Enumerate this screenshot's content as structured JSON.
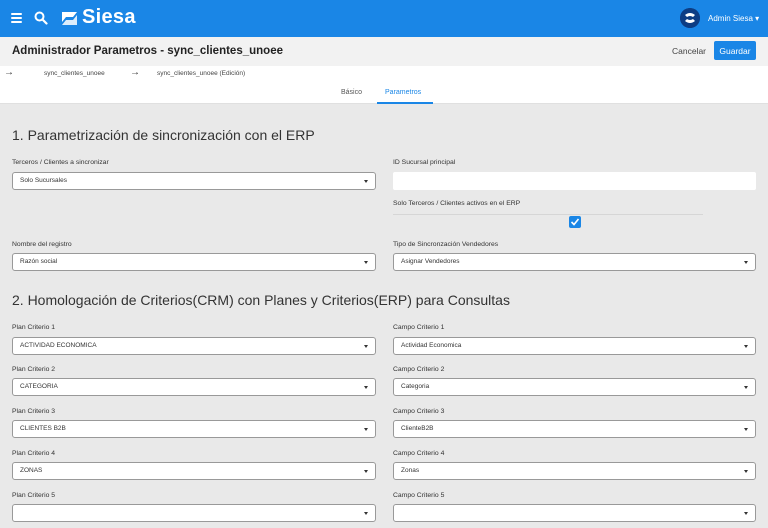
{
  "topbar": {
    "brand": "Siesa",
    "user_name": "Admin Siesa ▾"
  },
  "header": {
    "title": "Administrador Parametros - sync_clientes_unoee",
    "cancel_label": "Cancelar",
    "save_label": "Guardar"
  },
  "breadcrumb": {
    "items": [
      {
        "label": "sync_clientes_unoee"
      },
      {
        "label": "sync_clientes_unoee (Edición)"
      }
    ]
  },
  "tabs": [
    {
      "label": "Básico",
      "active": false
    },
    {
      "label": "Parametros",
      "active": true
    }
  ],
  "section1": {
    "title": "1. Parametrización de sincronización con el ERP",
    "terceros": {
      "label": "Terceros / Clientes a sincronizar",
      "value": "Solo Sucursales"
    },
    "sucursal": {
      "label": "ID Sucursal principal",
      "value": ""
    },
    "activos": {
      "label": "Solo Terceros / Clientes activos en el ERP",
      "checked": true
    },
    "nombre_registro": {
      "label": "Nombre del registro",
      "value": "Razón social"
    },
    "tipo_vendedores": {
      "label": "Tipo de Sincronzación Vendedores",
      "value": "Asignar Vendedores"
    }
  },
  "section2": {
    "title": "2. Homologación de Criterios(CRM) con Planes y Criterios(ERP) para Consultas",
    "rows": [
      {
        "plan_label": "Plan Criterio 1",
        "plan_value": "ACTIVIDAD ECONOMICA",
        "campo_label": "Campo Criterio 1",
        "campo_value": "Actividad Economica"
      },
      {
        "plan_label": "Plan Criterio 2",
        "plan_value": "CATEGORIA",
        "campo_label": "Campo Criterio 2",
        "campo_value": "Categoria"
      },
      {
        "plan_label": "Plan Criterio 3",
        "plan_value": "CLIENTES B2B",
        "campo_label": "Campo Criterio 3",
        "campo_value": "ClienteB2B"
      },
      {
        "plan_label": "Plan Criterio 4",
        "plan_value": "ZONAS",
        "campo_label": "Campo Criterio 4",
        "campo_value": "Zonas"
      },
      {
        "plan_label": "Plan Criterio 5",
        "plan_value": "",
        "campo_label": "Campo Criterio 5",
        "campo_value": ""
      }
    ]
  },
  "colors": {
    "primary": "#1a86e6",
    "topbar_bg": "#1a86e6",
    "page_bg": "#e9e9e9",
    "logo_dark": "#0d3d84"
  }
}
